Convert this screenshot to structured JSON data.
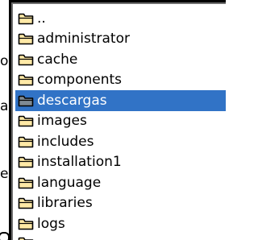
{
  "background_fragments": [
    "o",
    "a",
    "e"
  ],
  "folder_list": {
    "selected_index": 4,
    "items": [
      {
        "label": "..",
        "icon": "folder-icon"
      },
      {
        "label": "administrator",
        "icon": "folder-icon"
      },
      {
        "label": "cache",
        "icon": "folder-icon"
      },
      {
        "label": "components",
        "icon": "folder-icon"
      },
      {
        "label": "descargas",
        "icon": "folder-icon"
      },
      {
        "label": "images",
        "icon": "folder-icon"
      },
      {
        "label": "includes",
        "icon": "folder-icon"
      },
      {
        "label": "installation1",
        "icon": "folder-icon"
      },
      {
        "label": "language",
        "icon": "folder-icon"
      },
      {
        "label": "libraries",
        "icon": "folder-icon"
      },
      {
        "label": "logs",
        "icon": "folder-icon"
      },
      {
        "label": "",
        "icon": "folder-icon"
      }
    ]
  },
  "colors": {
    "selection": "#3173c6",
    "folder_fill": "#ffe9a6",
    "folder_outline": "#000000",
    "folder_selected_fill": "#7f8a93"
  }
}
